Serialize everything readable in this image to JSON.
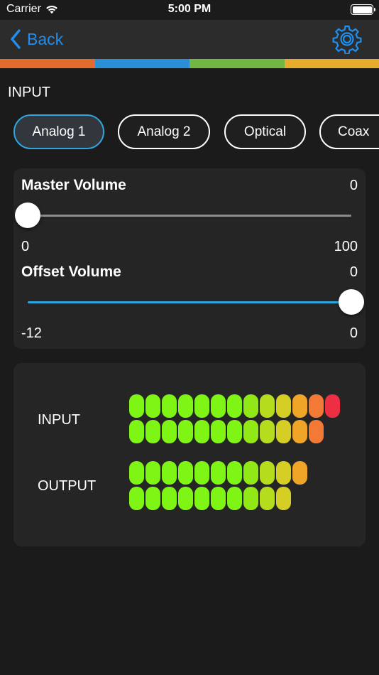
{
  "status_bar": {
    "carrier": "Carrier",
    "time": "5:00 PM"
  },
  "nav": {
    "back_label": "Back"
  },
  "color_strip": [
    "#e36b2c",
    "#2a8fd6",
    "#72b744",
    "#e7ac2c"
  ],
  "input_section": {
    "label": "INPUT",
    "tabs": [
      {
        "label": "Analog 1",
        "active": true
      },
      {
        "label": "Analog 2",
        "active": false
      },
      {
        "label": "Optical",
        "active": false
      },
      {
        "label": "Coax",
        "active": false
      }
    ]
  },
  "master_volume": {
    "title": "Master Volume",
    "value": "0",
    "min": "0",
    "max": "100",
    "level": 0
  },
  "offset_volume": {
    "title": "Offset  Volume",
    "value": "0",
    "min": "-12",
    "max": "0",
    "level": 1
  },
  "meters": {
    "input_label": "INPUT",
    "output_label": "OUTPUT",
    "segment_colors": [
      "#7ef514",
      "#7ef514",
      "#7ef514",
      "#7ef514",
      "#7ef514",
      "#7ef514",
      "#7ef514",
      "#90e817",
      "#b5dc1d",
      "#d5ce24",
      "#f0a528",
      "#f27a36",
      "#ee2e43"
    ],
    "rows": [
      {
        "channel": "input",
        "active_segments": 13
      },
      {
        "channel": "input",
        "active_segments": 12
      },
      {
        "channel": "output",
        "active_segments": 11
      },
      {
        "channel": "output",
        "active_segments": 10
      }
    ]
  }
}
